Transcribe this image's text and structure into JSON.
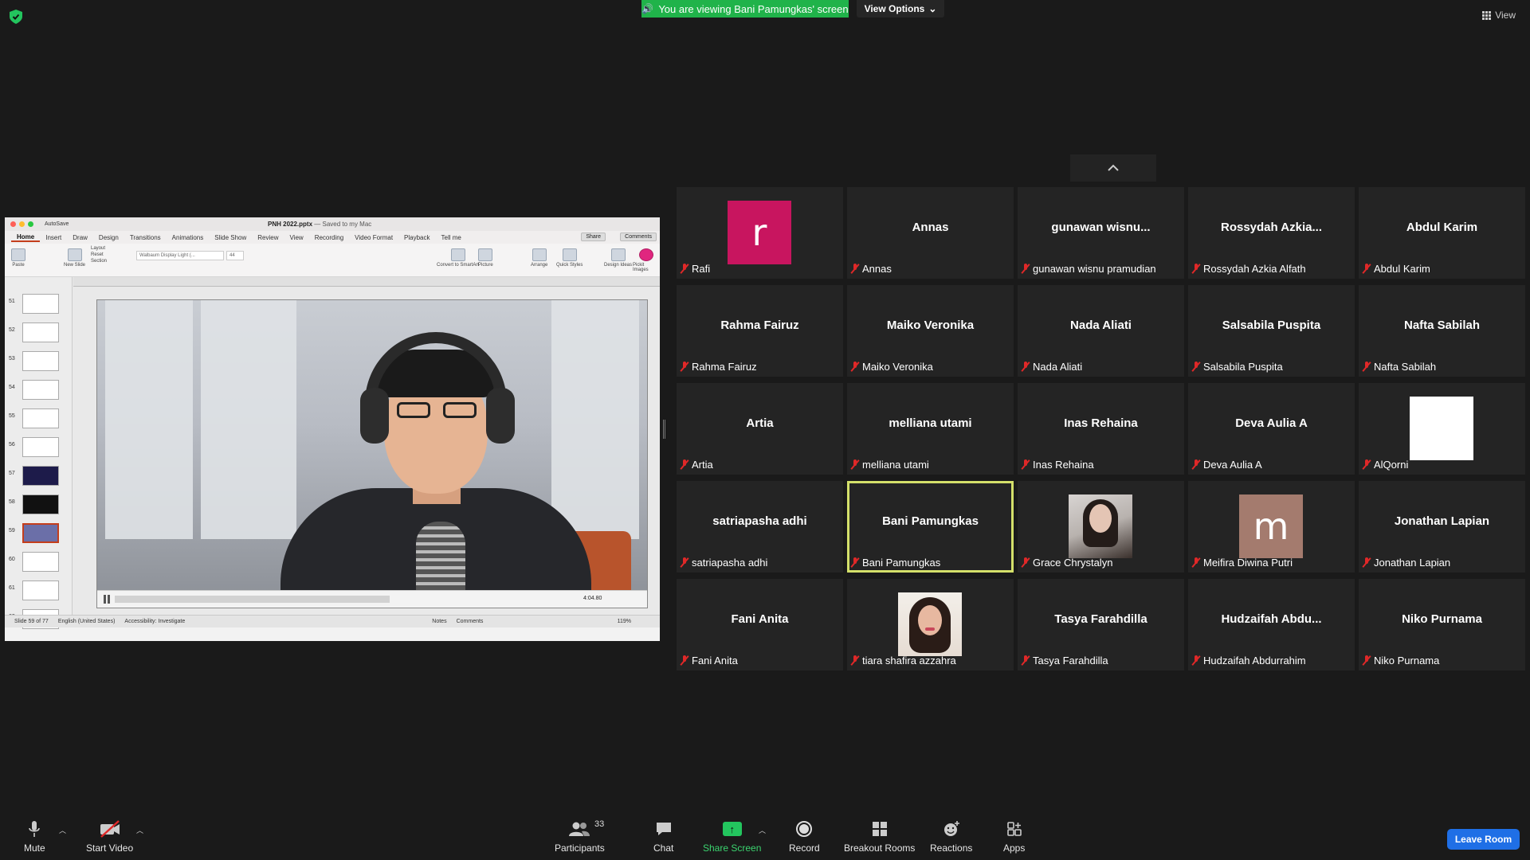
{
  "top": {
    "banner_text": "You are viewing Bani Pamungkas' screen",
    "view_options": "View Options",
    "view_label": "View"
  },
  "ppt": {
    "autosave": "AutoSave",
    "file_name": "PNH 2022.pptx",
    "saved": " — Saved to my Mac",
    "tabs": [
      "Home",
      "Insert",
      "Draw",
      "Design",
      "Transitions",
      "Animations",
      "Slide Show",
      "Review",
      "View",
      "Recording",
      "Video Format",
      "Playback",
      "Tell me"
    ],
    "share": "Share",
    "comments": "Comments",
    "ribbon": [
      "Paste",
      "New Slide",
      "Layout",
      "Reset",
      "Section",
      "Picture",
      "Arrange",
      "Quick Styles",
      "Design Ideas",
      "Pickit Images",
      "Convert to SmartArt"
    ],
    "font_name": "Walbaum Display Light (...",
    "font_size": "44",
    "thumbs": [
      "51",
      "52",
      "53",
      "54",
      "55",
      "56",
      "57",
      "58",
      "59",
      "60",
      "61",
      "62"
    ],
    "video_time": "4:04.80",
    "status_slide": "Slide 59 of 77",
    "status_lang": "English (United States)",
    "status_access": "Accessibility: Investigate",
    "status_notes": "Notes",
    "status_comments": "Comments",
    "zoom": "119%"
  },
  "participants": [
    {
      "display": "",
      "name": "Rafi",
      "avatar": "r",
      "avatar_color": "#c8155f"
    },
    {
      "display": "Annas",
      "name": "Annas"
    },
    {
      "display": "gunawan  wisnu...",
      "name": "gunawan wisnu pramudian"
    },
    {
      "display": "Rossydah  Azkia...",
      "name": "Rossydah Azkia Alfath"
    },
    {
      "display": "Abdul Karim",
      "name": "Abdul Karim"
    },
    {
      "display": "Rahma Fairuz",
      "name": "Rahma Fairuz"
    },
    {
      "display": "Maiko Veronika",
      "name": "Maiko Veronika"
    },
    {
      "display": "Nada Aliati",
      "name": "Nada Aliati"
    },
    {
      "display": "Salsabila Puspita",
      "name": "Salsabila Puspita"
    },
    {
      "display": "Nafta Sabilah",
      "name": "Nafta Sabilah"
    },
    {
      "display": "Artia",
      "name": "Artia"
    },
    {
      "display": "melliana utami",
      "name": "melliana utami"
    },
    {
      "display": "Inas Rehaina",
      "name": "Inas Rehaina"
    },
    {
      "display": "Deva Aulia A",
      "name": "Deva Aulia A"
    },
    {
      "display": "",
      "name": "AlQorni"
    },
    {
      "display": "satriapasha adhi",
      "name": "satriapasha adhi"
    },
    {
      "display": "Bani Pamungkas",
      "name": "Bani Pamungkas"
    },
    {
      "display": "",
      "name": "Grace Chrystalyn"
    },
    {
      "display": "",
      "name": "Meifira Diwina Putri",
      "avatar": "m",
      "avatar_color": "#a47b6e"
    },
    {
      "display": "Jonathan Lapian",
      "name": "Jonathan Lapian"
    },
    {
      "display": "Fani Anita",
      "name": "Fani Anita"
    },
    {
      "display": "",
      "name": "tiara shafira azzahra"
    },
    {
      "display": "Tasya Farahdilla",
      "name": "Tasya Farahdilla"
    },
    {
      "display": "Hudzaifah  Abdu...",
      "name": "Hudzaifah Abdurrahim"
    },
    {
      "display": "Niko Purnama",
      "name": "Niko Purnama"
    }
  ],
  "toolbar": {
    "mute": "Mute",
    "start_video": "Start Video",
    "participants": "Participants",
    "participant_count": "33",
    "chat": "Chat",
    "share_screen": "Share Screen",
    "record": "Record",
    "breakout": "Breakout Rooms",
    "reactions": "Reactions",
    "apps": "Apps",
    "leave": "Leave Room"
  },
  "colors": {
    "banner_green": "#20b34a",
    "active_speaker": "#d4e06a",
    "leave_blue": "#1f6fe6",
    "muted_red": "#e02828"
  }
}
